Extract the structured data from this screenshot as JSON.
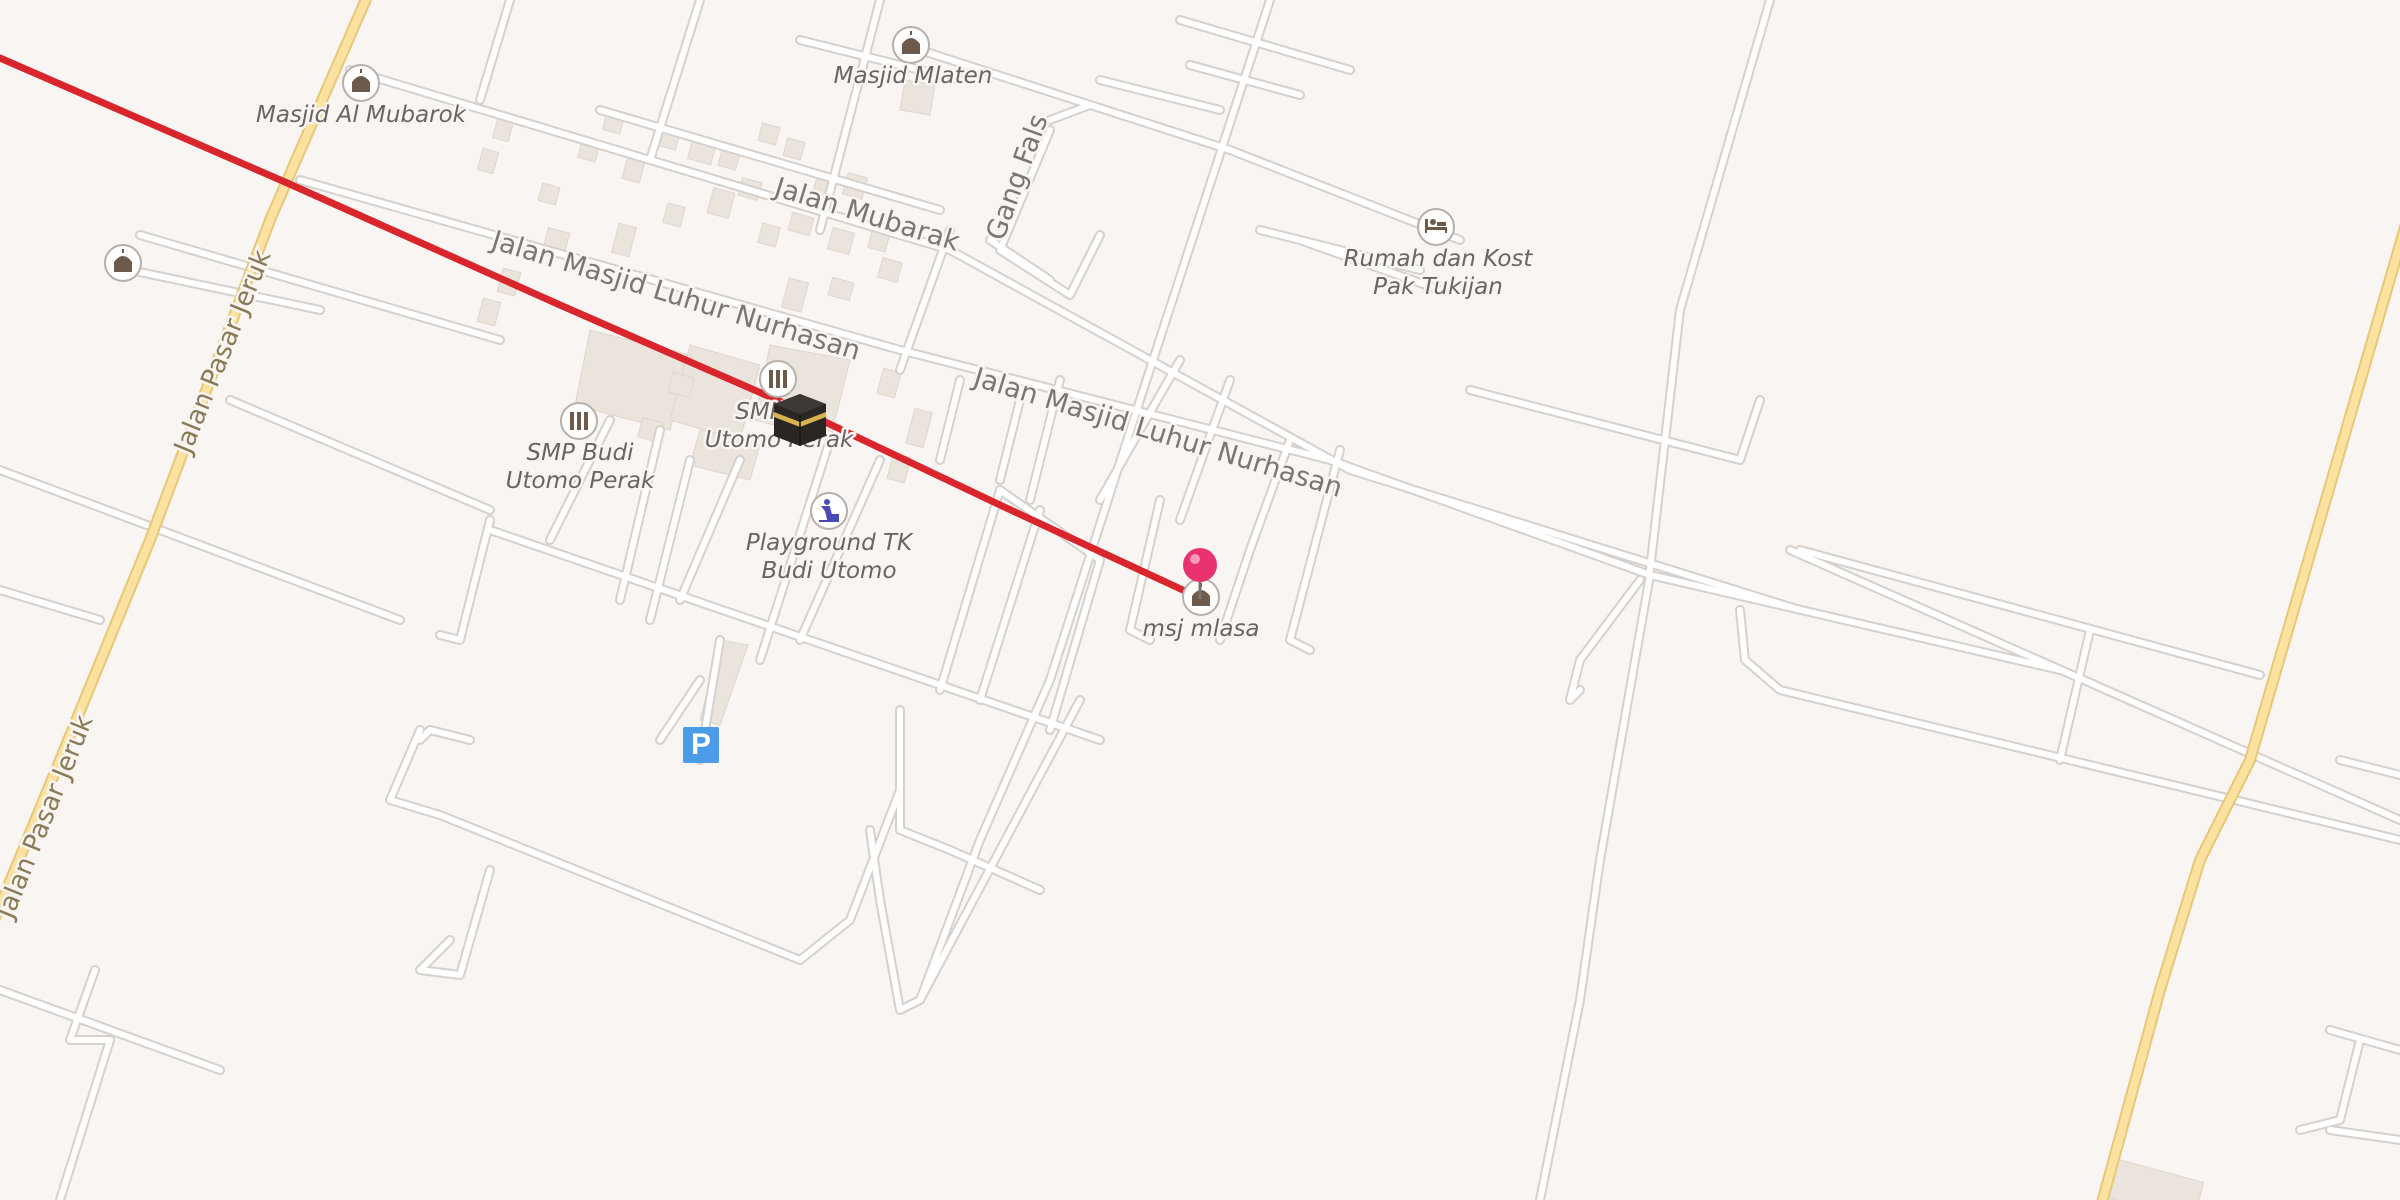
{
  "streets": {
    "jalan_pasar_jeruk": "Jalan Pasar Jeruk",
    "jalan_mubarak": "Jalan Mubarak",
    "gang_fals": "Gang Fals",
    "jalan_masjid_luhur_nurhasan": "Jalan Masjid Luhur Nurhasan"
  },
  "pois": {
    "masjid_al_mubarok": "Masjid Al Mubarok",
    "masjid_mlaten": "Masjid Mlaten",
    "rumah_kost_line1": "Rumah dan Kost",
    "rumah_kost_line2": "Pak Tukijan",
    "smp_budi_line1": "SMP Budi",
    "smp_budi_line2": "Utomo Perak",
    "smk_line1": "SMK",
    "smk_line2": "Utomo Perak",
    "playground_line1": "Playground TK",
    "playground_line2": "Budi Utomo",
    "msj_mlasa": "msj mlasa"
  },
  "parking_label": "P",
  "colors": {
    "background": "#f8f5f2",
    "road": "#ffffff",
    "road_casing": "#d6d1cc",
    "major_road": "#fbe2a0",
    "major_road_casing": "#e8c878",
    "route_line": "#d9262c",
    "marker": "#e8336f",
    "parking": "#4a9be8",
    "building": "#ebe4dd"
  },
  "icons": {
    "mosque": "mosque-icon",
    "school": "school-icon",
    "hotel": "bed-icon",
    "playground": "playground-icon",
    "kaaba": "kaaba-icon",
    "pin": "location-pin-icon",
    "parking": "parking-icon"
  }
}
